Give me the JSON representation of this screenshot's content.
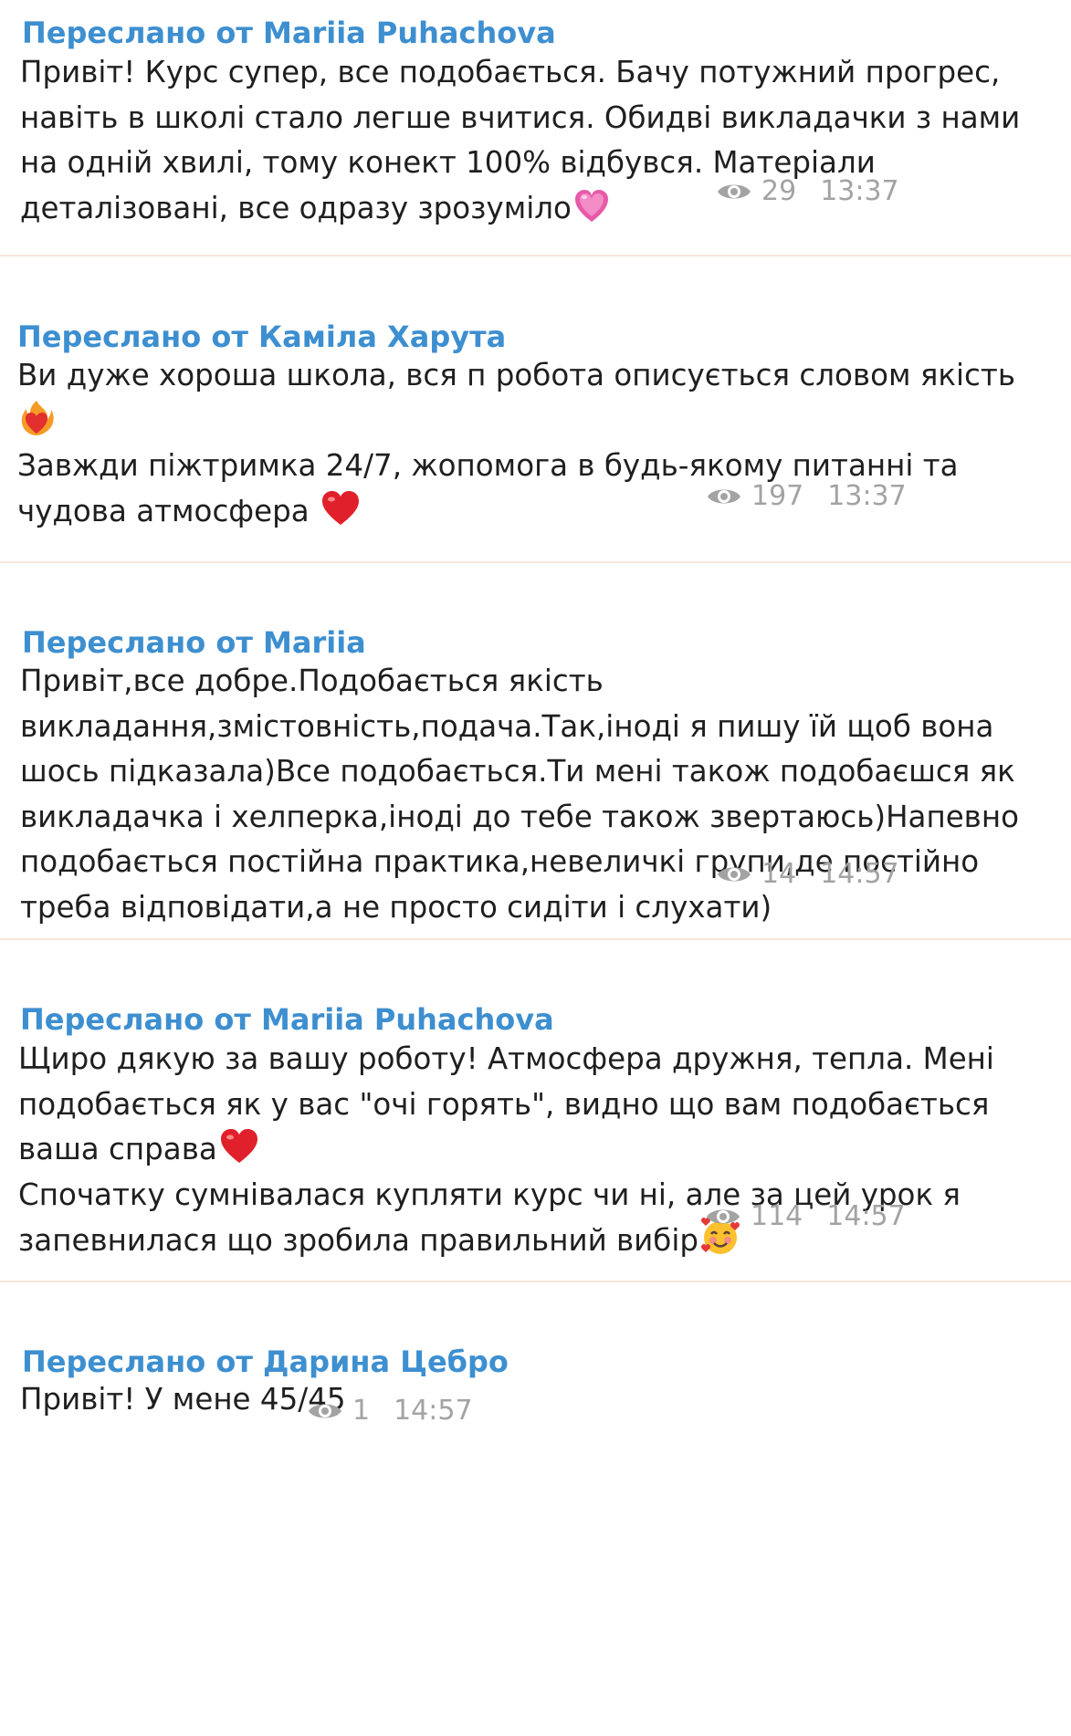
{
  "messages": [
    {
      "forwarded_from": "Переслано от Mariia Puhachova",
      "lines": [
        "Привіт! Курс супер, все подобається. Бачу потужний прогрес,",
        "навіть в школі стало легше вчитися. Обидві викладачки з нами",
        "на одній хвилі, тому конект 100% відбувся. Матеріали",
        "деталізовані, все одразу зрозуміло"
      ],
      "emoji": "pink-heart",
      "views": "29",
      "time": "13:37"
    },
    {
      "forwarded_from": "Переслано от Каміла Харута",
      "lines": [
        "Ви дуже хороша школа, вся п робота описується словом якість",
        "",
        "Завжди піжтримка 24/7, жопомога в будь-якому питанні та",
        "чудова атмосфера"
      ],
      "emoji_line2": "heart-on-fire",
      "emoji": "red-heart",
      "views": "197",
      "time": "13:37"
    },
    {
      "forwarded_from": "Переслано от Mariia",
      "lines": [
        "Привіт,все добре.Подобається якість",
        "викладання,змістовність,подача.Так,іноді я пишу їй щоб вона",
        "шось підказала)Все подобається.Ти мені також подобаєшся як",
        "викладачка і хелперка,іноді до тебе також звертаюсь)Напевно",
        "подобається постійна практика,невеличкі групи,де постійно",
        "треба відповідати,а не просто сидіти і слухати)"
      ],
      "views": "14",
      "time": "14:57"
    },
    {
      "forwarded_from": "Переслано от Mariia Puhachova",
      "lines": [
        "Щиро дякую за вашу роботу! Атмосфера дружня, тепла. Мені",
        "подобається як у вас \"очі горять\", видно що вам подобається",
        "ваша справа",
        "Спочатку сумнівалася купляти курс чи ні, але за цей урок я",
        "запевнилася що зробила правильний вибір"
      ],
      "emoji_line3": "red-heart",
      "emoji": "smiling-face-with-hearts",
      "views": "114",
      "time": "14:57"
    },
    {
      "forwarded_from": "Переслано от Дарина Цебро",
      "lines": [
        "Привіт! У мене 45/45"
      ],
      "views": "1",
      "time": "14:57"
    }
  ],
  "colors": {
    "forward_label": "#3d8fd0",
    "text": "#1f1f1f",
    "meta": "#a3a3a3",
    "separator": "#f7e6dc"
  },
  "icons": {
    "views": "eye-icon"
  }
}
